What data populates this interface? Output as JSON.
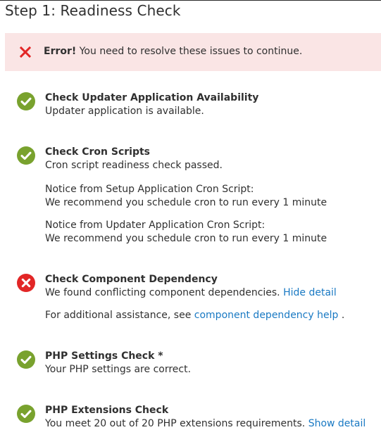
{
  "page": {
    "title": "Step 1: Readiness Check"
  },
  "error_banner": {
    "label": "Error!",
    "message": " You need to resolve these issues to continue."
  },
  "checks": [
    {
      "status": "success",
      "title": "Check Updater Application Availability",
      "message": "Updater application is available."
    },
    {
      "status": "success",
      "title": "Check Cron Scripts",
      "message": "Cron script readiness check passed.",
      "notices": [
        {
          "heading": "Notice from Setup Application Cron Script:",
          "text": "We recommend you schedule cron to run every 1 minute"
        },
        {
          "heading": "Notice from Updater Application Cron Script:",
          "text": "We recommend you schedule cron to run every 1 minute"
        }
      ]
    },
    {
      "status": "error",
      "title": "Check Component Dependency",
      "message": "We found conflicting component dependencies.",
      "toggle_label": "Hide detail",
      "help_prefix": "For additional assistance, see",
      "help_link": "component dependency help",
      "help_suffix": "."
    },
    {
      "status": "success",
      "title": "PHP Settings Check *",
      "message": "Your PHP settings are correct."
    },
    {
      "status": "success",
      "title": "PHP Extensions Check",
      "message": "You meet 20 out of 20 PHP extensions requirements.",
      "toggle_label": "Show detail"
    }
  ],
  "colors": {
    "success": "#79a22e",
    "error": "#e22626",
    "link": "#1979c3",
    "banner_bg": "#fae5e5"
  },
  "icons": {
    "success": "checkmark-circle-icon",
    "error": "x-circle-icon",
    "banner": "x-icon"
  }
}
